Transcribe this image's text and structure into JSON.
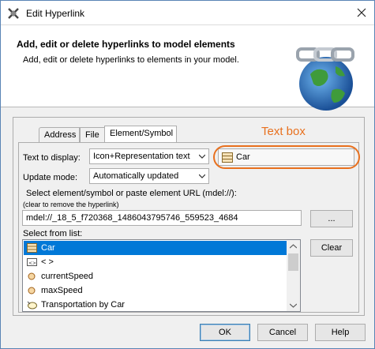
{
  "window": {
    "title": "Edit Hyperlink"
  },
  "header": {
    "title": "Add, edit or delete hyperlinks to model elements",
    "description": "Add, edit or delete hyperlinks to elements in your model."
  },
  "tabs": [
    {
      "label": "Address"
    },
    {
      "label": "File"
    },
    {
      "label": "Element/Symbol"
    }
  ],
  "form": {
    "text_to_display_label": "Text to display:",
    "text_to_display_value": "Icon+Representation text",
    "display_text_value": "Car",
    "update_mode_label": "Update mode:",
    "update_mode_value": "Automatically updated",
    "select_instruction": "Select element/symbol or paste element URL (mdel://):",
    "clear_hint": "(clear to remove the hyperlink)",
    "url_value": "mdel://_18_5_f720368_1486043795746_559523_4684",
    "browse_label": "...",
    "select_from_list_label": "Select from list:",
    "clear_button_label": "Clear"
  },
  "list_items": [
    {
      "label": "Car",
      "icon": "class-icon",
      "selected": true
    },
    {
      "label": "< >",
      "icon": "association-icon",
      "selected": false
    },
    {
      "label": "currentSpeed",
      "icon": "property-icon",
      "selected": false
    },
    {
      "label": "maxSpeed",
      "icon": "property-icon",
      "selected": false
    },
    {
      "label": "Transportation by Car",
      "icon": "use-case-icon",
      "selected": false
    }
  ],
  "annotation": {
    "label": "Text box",
    "color": "#e8701e"
  },
  "footer": {
    "ok_label": "OK",
    "cancel_label": "Cancel",
    "help_label": "Help"
  },
  "colors": {
    "selection": "#0078d7",
    "accent": "#e8701e"
  }
}
